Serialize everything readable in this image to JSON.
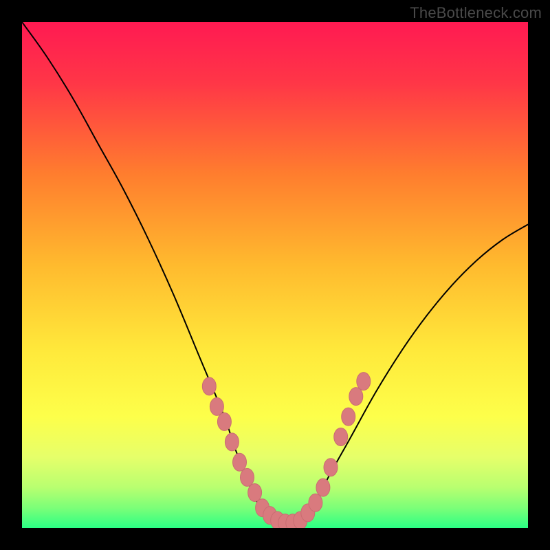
{
  "watermark": "TheBottleneck.com",
  "colors": {
    "frame": "#000000",
    "gradient_top": "#ff1a52",
    "gradient_mid_upper": "#ff8a2a",
    "gradient_mid": "#ffe93b",
    "gradient_lower": "#e6ff6a",
    "gradient_bottom": "#2bff84",
    "curve": "#000000",
    "marker_fill": "#d97a7e",
    "marker_stroke": "#c96d72"
  },
  "chart_data": {
    "type": "line",
    "title": "",
    "xlabel": "",
    "ylabel": "",
    "xlim": [
      0,
      100
    ],
    "ylim": [
      0,
      100
    ],
    "series": [
      {
        "name": "bottleneck-curve",
        "x": [
          0,
          5,
          10,
          15,
          20,
          25,
          30,
          35,
          40,
          42,
          44,
          46,
          48,
          50,
          52,
          54,
          56,
          58,
          60,
          65,
          70,
          75,
          80,
          85,
          90,
          95,
          100
        ],
        "y": [
          100,
          93,
          85,
          76,
          67,
          57,
          46,
          34,
          22,
          16,
          11,
          6,
          3,
          1,
          0,
          0,
          1,
          4,
          9,
          18,
          27,
          35,
          42,
          48,
          53,
          57,
          60
        ]
      }
    ],
    "markers": [
      {
        "x": 37,
        "y": 28
      },
      {
        "x": 38.5,
        "y": 24
      },
      {
        "x": 40,
        "y": 21
      },
      {
        "x": 41.5,
        "y": 17
      },
      {
        "x": 43,
        "y": 13
      },
      {
        "x": 44.5,
        "y": 10
      },
      {
        "x": 46,
        "y": 7
      },
      {
        "x": 47.5,
        "y": 4
      },
      {
        "x": 49,
        "y": 2.5
      },
      {
        "x": 50.5,
        "y": 1.5
      },
      {
        "x": 52,
        "y": 1
      },
      {
        "x": 53.5,
        "y": 1
      },
      {
        "x": 55,
        "y": 1.5
      },
      {
        "x": 56.5,
        "y": 3
      },
      {
        "x": 58,
        "y": 5
      },
      {
        "x": 59.5,
        "y": 8
      },
      {
        "x": 61,
        "y": 12
      },
      {
        "x": 63,
        "y": 18
      },
      {
        "x": 64.5,
        "y": 22
      },
      {
        "x": 66,
        "y": 26
      },
      {
        "x": 67.5,
        "y": 29
      }
    ]
  }
}
